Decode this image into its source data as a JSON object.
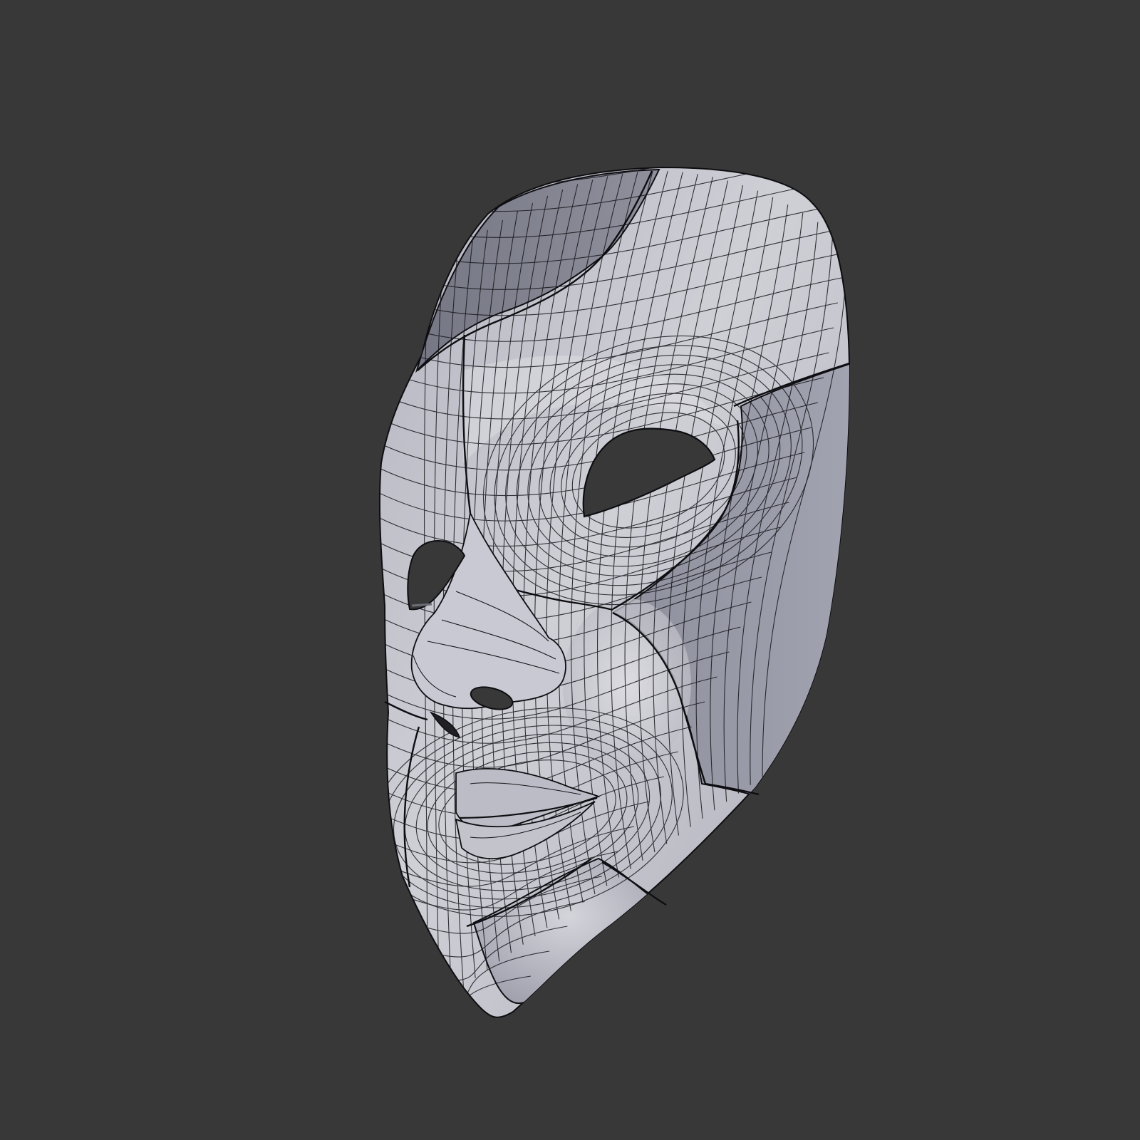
{
  "scene": {
    "subject": "mask-wireframe-render",
    "colors": {
      "background": "#383838",
      "surface_light": "#c6c6cf",
      "surface_mid": "#a9a9b6",
      "surface_dark": "#7c7d8a",
      "wire": "#121216",
      "hole": "#383838"
    }
  }
}
